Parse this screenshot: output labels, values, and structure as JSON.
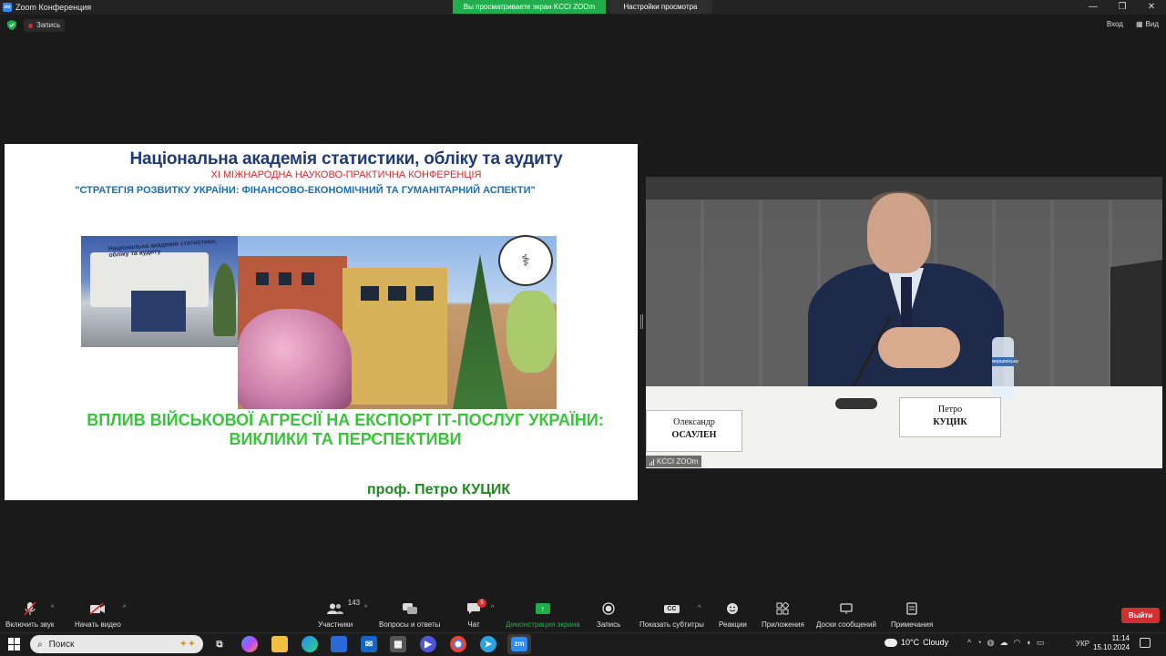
{
  "window": {
    "title": "Zoom Конференция",
    "share_banner": "Вы просматриваете экран KCCI ZOOm",
    "view_settings": "Настройки просмотра",
    "controls": [
      "—",
      "❐",
      "✕"
    ]
  },
  "topbar": {
    "record_label": "Запись",
    "exit_label": "Вход",
    "view_label": "Вид"
  },
  "slide": {
    "title": "Національна академія статистики, обліку та аудиту",
    "conference": "ХІ МІЖНАРОДНА НАУКОВО-ПРАКТИЧНА КОНФЕРЕНЦІЯ",
    "theme": "\"СТРАТЕГІЯ РОЗВИТКУ УКРАЇНИ: ФІНАНСОВО-ЕКОНОМІЧНИЙ ТА ГУМАНІТАРНИЙ АСПЕКТИ\"",
    "photo_sign": "Національна академія статистики, обліку та аудиту",
    "heading_line1": "ВПЛИВ ВІЙСЬКОВОЇ АГРЕСІЇ НА ЕКСПОРТ ІТ-ПОСЛУГ УКРАЇНИ:",
    "heading_line2": "ВИКЛИКИ ТА ПЕРСПЕКТИВИ",
    "author": "проф. Петро КУЦИК"
  },
  "video": {
    "nameplate_main_line1": "Петро",
    "nameplate_main_line2": "КУЦИК",
    "nameplate_side_line1": "Олександр",
    "nameplate_side_line2": "ОСАУЛЕН",
    "bottle_label": "моршинська",
    "caption": "KCCI ZOOm"
  },
  "toolbar": {
    "items": [
      {
        "label": "Включить звук",
        "icon": "muted-mic-icon"
      },
      {
        "label": "Начать видео",
        "icon": "video-off-icon"
      },
      {
        "label": "Участники",
        "icon": "participants-icon",
        "count": "143"
      },
      {
        "label": "Вопросы и ответы",
        "icon": "qa-icon"
      },
      {
        "label": "Чат",
        "icon": "chat-icon",
        "badge": "5"
      },
      {
        "label": "Демонстрация экрана",
        "icon": "share-screen-icon"
      },
      {
        "label": "Запись",
        "icon": "record-icon"
      },
      {
        "label": "Показать субтитры",
        "icon": "cc-icon",
        "glyph": "CC"
      },
      {
        "label": "Реакции",
        "icon": "reactions-icon"
      },
      {
        "label": "Приложения",
        "icon": "apps-icon"
      },
      {
        "label": "Доски сообщений",
        "icon": "whiteboard-icon"
      },
      {
        "label": "Примечания",
        "icon": "notes-icon"
      }
    ],
    "leave_label": "Выйти",
    "accent": "#1fae4b",
    "leave_color": "#d32f2f"
  },
  "taskbar": {
    "search_placeholder": "Поиск",
    "zoom_label": "zm",
    "weather_temp": "10°C",
    "weather_text": "Cloudy",
    "lang": "УКР",
    "time": "11:14",
    "date": "15.10.2024"
  }
}
